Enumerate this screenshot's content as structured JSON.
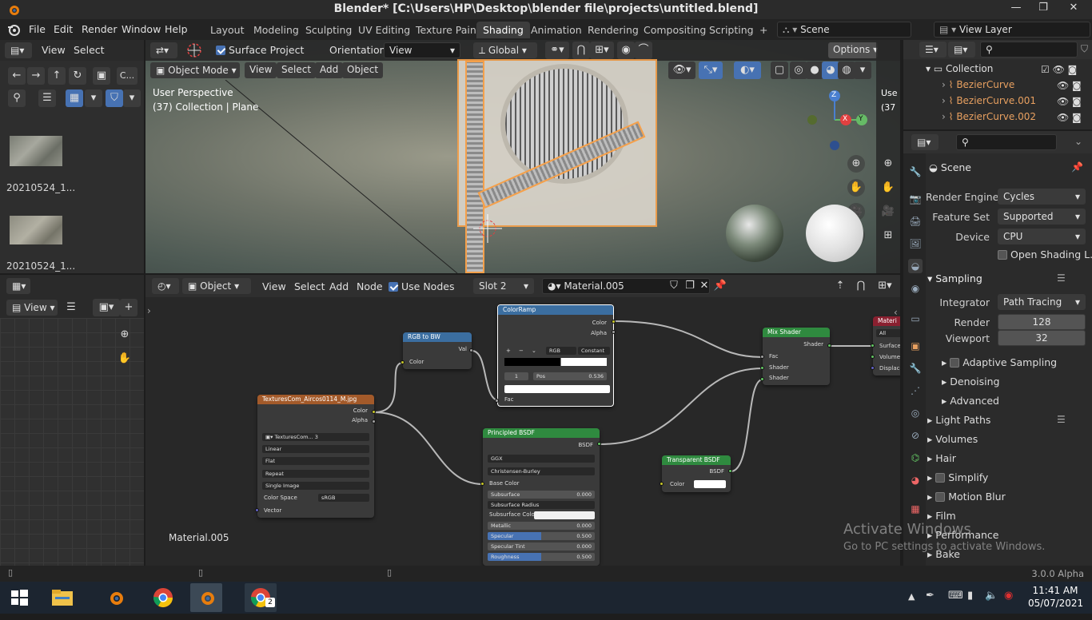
{
  "window": {
    "title": "Blender* [C:\\Users\\HP\\Desktop\\blender file\\projects\\untitled.blend]",
    "minimize": "—",
    "restore": "❐",
    "close": "✕"
  },
  "menu": {
    "items": [
      "File",
      "Edit",
      "Render",
      "Window",
      "Help"
    ]
  },
  "workspaces": {
    "tabs": [
      "Layout",
      "Modeling",
      "Sculpting",
      "UV Editing",
      "Texture Paint",
      "Shading",
      "Animation",
      "Rendering",
      "Compositing",
      "Scripting"
    ],
    "active": "Shading",
    "add": "+"
  },
  "scene_selector": {
    "scene": "Scene",
    "view_layer": "View Layer"
  },
  "file_browser": {
    "menu": [
      "View",
      "Select"
    ],
    "path_label": "C...",
    "thumbnails": [
      {
        "label": "20210524_1..."
      },
      {
        "label": "20210524_1..."
      }
    ]
  },
  "image_editor": {
    "view_label": "View"
  },
  "viewport": {
    "surface_project": "Surface Project",
    "orientation_label": "Orientation:",
    "orientation_value": "View",
    "transform_orientation": "Global",
    "options": "Options",
    "mode": "Object Mode",
    "menu": [
      "View",
      "Select",
      "Add",
      "Object"
    ],
    "info_line1": "User Perspective",
    "info_line2": "(37) Collection | Plane",
    "gizmo": {
      "x": "X",
      "y": "Y",
      "z": "Z"
    },
    "side_snippet": "Use",
    "side_snippet2": "(37"
  },
  "node_editor": {
    "editor_type": "Object",
    "menu": [
      "View",
      "Select",
      "Add",
      "Node"
    ],
    "use_nodes": "Use Nodes",
    "slot": "Slot 2",
    "material": "Material.005",
    "footer_material": "Material.005",
    "nodes": {
      "image_texture": {
        "title": "TexturesCom_Aircos0114_M.jpg",
        "out_color": "Color",
        "out_alpha": "Alpha",
        "image_name": "TexturesCom...",
        "users": "3",
        "interpolation": "Linear",
        "projection": "Flat",
        "extension": "Repeat",
        "source": "Single Image",
        "color_space_label": "Color Space",
        "color_space": "sRGB",
        "in_vector": "Vector"
      },
      "rgb_to_bw": {
        "title": "RGB to BW",
        "out_val": "Val",
        "in_color": "Color"
      },
      "color_ramp": {
        "title": "ColorRamp",
        "out_color": "Color",
        "out_alpha": "Alpha",
        "add": "+",
        "remove": "−",
        "mode": "RGB",
        "interp": "Constant",
        "index": "1",
        "pos_label": "Pos",
        "pos_value": "0.536",
        "in_fac": "Fac"
      },
      "principled": {
        "title": "Principled BSDF",
        "out_bsdf": "BSDF",
        "distribution": "GGX",
        "subsurface_method": "Christensen-Burley",
        "rows": [
          {
            "label": "Base Color",
            "type": "socket"
          },
          {
            "label": "Subsurface",
            "value": "0.000",
            "fill": 0
          },
          {
            "label": "Subsurface Radius",
            "type": "select"
          },
          {
            "label": "Subsurface Colo",
            "type": "color"
          },
          {
            "label": "Metallic",
            "value": "0.000",
            "fill": 0
          },
          {
            "label": "Specular",
            "value": "0.500",
            "fill": 0.5
          },
          {
            "label": "Specular Tint",
            "value": "0.000",
            "fill": 0
          },
          {
            "label": "Roughness",
            "value": "0.500",
            "fill": 0.5
          }
        ]
      },
      "transparent": {
        "title": "Transparent BSDF",
        "out_bsdf": "BSDF",
        "in_color": "Color"
      },
      "mix_shader": {
        "title": "Mix Shader",
        "out_shader": "Shader",
        "in_fac": "Fac",
        "in_shader1": "Shader",
        "in_shader2": "Shader"
      },
      "material_output": {
        "title": "Materi",
        "target": "All",
        "in_surface": "Surface",
        "in_volume": "Volume",
        "in_displacement": "Displacen"
      }
    }
  },
  "outliner": {
    "collection": "Collection",
    "items": [
      "BezierCurve",
      "BezierCurve.001",
      "BezierCurve.002"
    ]
  },
  "properties": {
    "context": "Scene",
    "render_engine_label": "Render Engine",
    "render_engine": "Cycles",
    "feature_set_label": "Feature Set",
    "feature_set": "Supported",
    "device_label": "Device",
    "device": "CPU",
    "open_shading": "Open Shading L...",
    "sampling": "Sampling",
    "integrator_label": "Integrator",
    "integrator": "Path Tracing",
    "render_label": "Render",
    "render_samples": "128",
    "viewport_label": "Viewport",
    "viewport_samples": "32",
    "sub_panels": [
      "Adaptive Sampling",
      "Denoising",
      "Advanced"
    ],
    "panels": [
      "Light Paths",
      "Volumes",
      "Hair",
      "Simplify",
      "Motion Blur",
      "Film",
      "Performance",
      "Bake"
    ]
  },
  "watermark": {
    "line1": "Activate Windows",
    "line2": "Go to PC settings to activate Windows."
  },
  "statusbar": {
    "version": "3.0.0 Alpha"
  },
  "taskbar": {
    "time": "11:41 AM",
    "date": "05/07/2021",
    "chrome_badge": "2"
  },
  "colors": {
    "accent": "#4772b3",
    "selection_orange": "#f5a04a",
    "node_texture_header": "#a35a2a",
    "node_converter_header": "#3b6ea0",
    "node_shader_header": "#2f8a3f",
    "node_output_header": "#8a2030"
  }
}
